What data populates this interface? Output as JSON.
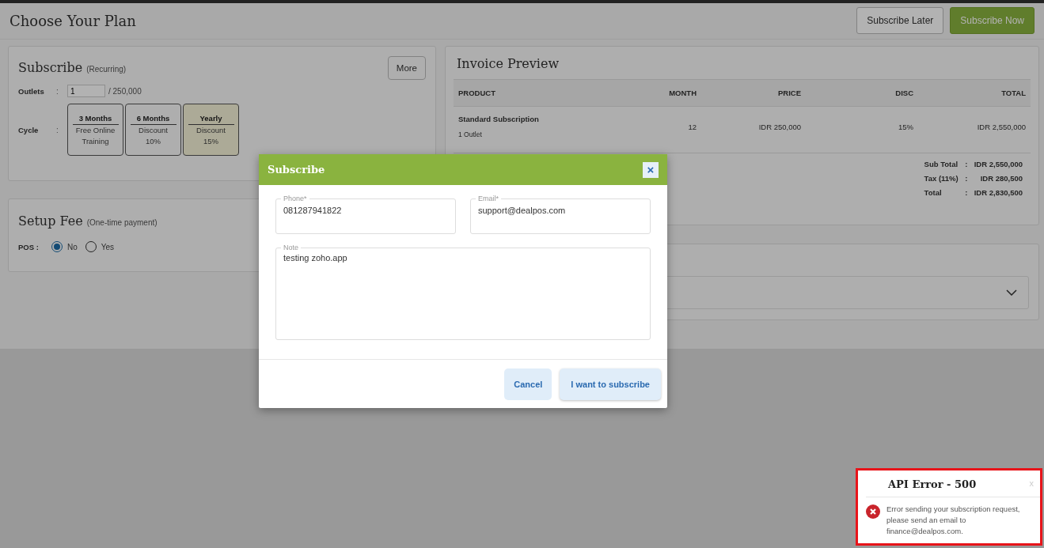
{
  "header": {
    "title": "Choose Your Plan",
    "buttons": [
      {
        "label": "Subscribe Later",
        "kind": "outline"
      },
      {
        "label": "Subscribe Now",
        "kind": "primary"
      }
    ]
  },
  "subscribe_card": {
    "title": "Subscribe",
    "subtitle": "(Recurring)",
    "more_button": "More",
    "outlets_label": "Outlets",
    "separator": ":",
    "outlets_value": "1",
    "outlets_max": "/ 250,000",
    "cycle_label": "Cycle",
    "cycles": [
      {
        "title": "3 Months",
        "line_1": "Free Online",
        "line_2": "Training",
        "selected": false
      },
      {
        "title": "6 Months",
        "line_1": "Discount",
        "line_2": "10%",
        "selected": false
      },
      {
        "title": "Yearly",
        "line_1": "Discount",
        "line_2": "15%",
        "selected": true
      }
    ]
  },
  "setup_fee_card": {
    "title": "Setup Fee",
    "subtitle": "(One-time payment)",
    "pos_label": "POS :",
    "options": [
      {
        "label": "No",
        "selected": true
      },
      {
        "label": "Yes",
        "selected": false
      }
    ]
  },
  "invoice": {
    "title": "Invoice Preview",
    "columns": [
      "PRODUCT",
      "MONTH",
      "PRICE",
      "DISC",
      "TOTAL"
    ],
    "rows": [
      {
        "product": "Standard Subscription",
        "detail": "1 Outlet",
        "month": "12",
        "price": "IDR 250,000",
        "disc": "15%",
        "total": "IDR 2,550,000"
      }
    ],
    "summary_separator": ":",
    "summary": [
      {
        "label": "Sub Total",
        "value": "IDR 2,550,000"
      },
      {
        "label": "Tax (11%)",
        "value": "IDR 280,500"
      },
      {
        "label": "Total",
        "value": "IDR 2,830,500"
      }
    ]
  },
  "dialog": {
    "title": "Subscribe",
    "close": "×",
    "phone_label": "Phone*",
    "phone": "081287941822",
    "email_label": "Email*",
    "email": "support@dealpos.com",
    "note_label": "Note",
    "note": "testing zoho.app",
    "buttons": [
      "Cancel",
      "I want to subscribe"
    ]
  },
  "toast": {
    "title": "API Error - 500",
    "close": "x",
    "message": "Error sending your subscription request, please send an email to finance@dealpos.com."
  }
}
